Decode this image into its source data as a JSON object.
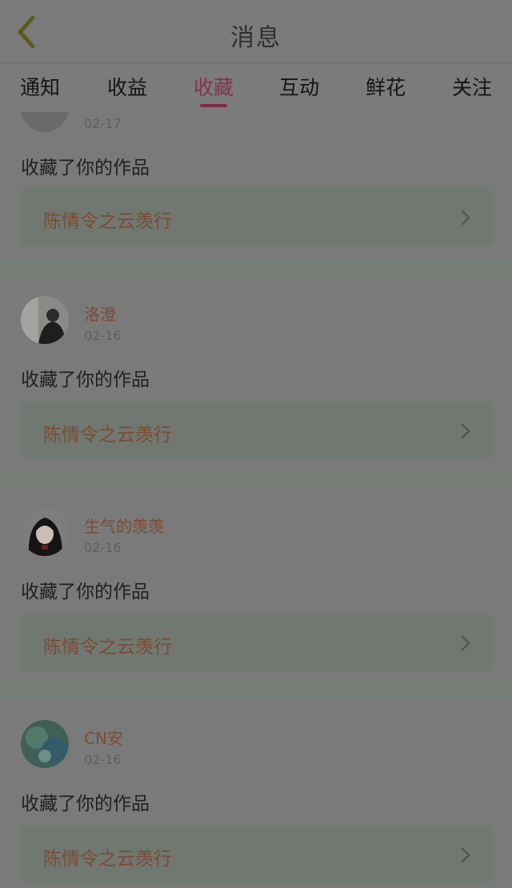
{
  "header": {
    "title": "消息"
  },
  "tabs": [
    {
      "label": "通知",
      "active": false
    },
    {
      "label": "收益",
      "active": false
    },
    {
      "label": "收藏",
      "active": true
    },
    {
      "label": "互动",
      "active": false
    },
    {
      "label": "鲜花",
      "active": false
    },
    {
      "label": "关注",
      "active": false
    }
  ],
  "colors": {
    "accent": "#80344c",
    "username": "#7a4a33",
    "work_title": "#7a4b35"
  },
  "items": [
    {
      "username": "",
      "date": "02-17",
      "action": "收藏了你的作品",
      "work_title": "陈情令之云羡行",
      "avatar_icon": "avatar-partial"
    },
    {
      "username": "洛澄",
      "date": "02-16",
      "action": "收藏了你的作品",
      "work_title": "陈情令之云羡行",
      "avatar_icon": "avatar-photo"
    },
    {
      "username": "生气的羡羡",
      "date": "02-16",
      "action": "收藏了你的作品",
      "work_title": "陈情令之云羡行",
      "avatar_icon": "avatar-anime"
    },
    {
      "username": "CN安",
      "date": "02-16",
      "action": "收藏了你的作品",
      "work_title": "陈情令之云羡行",
      "avatar_icon": "avatar-landscape"
    }
  ]
}
